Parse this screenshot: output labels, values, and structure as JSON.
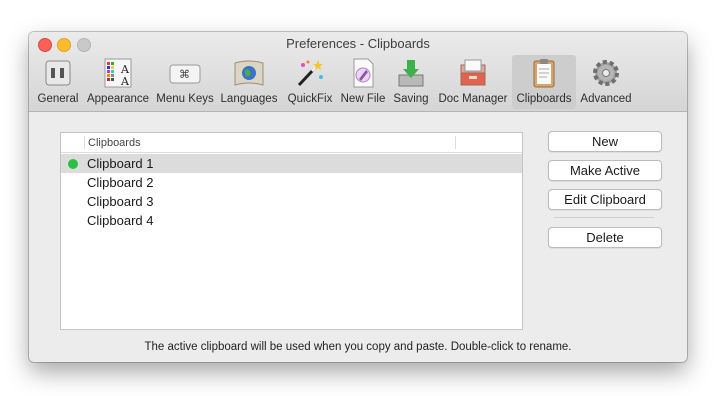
{
  "window": {
    "title": "Preferences - Clipboards"
  },
  "toolbar": {
    "items": [
      {
        "label": "General",
        "icon": "general-icon"
      },
      {
        "label": "Appearance",
        "icon": "appearance-icon"
      },
      {
        "label": "Menu Keys",
        "icon": "menu-keys-icon"
      },
      {
        "label": "Languages",
        "icon": "languages-icon"
      },
      {
        "label": "QuickFix",
        "icon": "quickfix-icon"
      },
      {
        "label": "New File",
        "icon": "new-file-icon"
      },
      {
        "label": "Saving",
        "icon": "saving-icon"
      },
      {
        "label": "Doc Manager",
        "icon": "doc-manager-icon"
      },
      {
        "label": "Clipboards",
        "icon": "clipboards-icon",
        "selected": true
      },
      {
        "label": "Advanced",
        "icon": "advanced-icon"
      }
    ],
    "menu_keys_glyph": "⌘",
    "appearance_glyph": "A"
  },
  "table": {
    "column_header": "Clipboards",
    "rows": [
      {
        "name": "Clipboard 1",
        "active": true
      },
      {
        "name": "Clipboard 2",
        "active": false
      },
      {
        "name": "Clipboard 3",
        "active": false
      },
      {
        "name": "Clipboard 4",
        "active": false
      }
    ]
  },
  "buttons": {
    "new": "New",
    "make_active": "Make Active",
    "edit_clipboard": "Edit Clipboard",
    "delete": "Delete"
  },
  "footer": "The active clipboard will be used when you copy and paste.  Double-click to rename.",
  "colors": {
    "active_dot": "#29c043",
    "selected_row": "#dcdcdc",
    "selected_tool": "#cdcdcd"
  }
}
